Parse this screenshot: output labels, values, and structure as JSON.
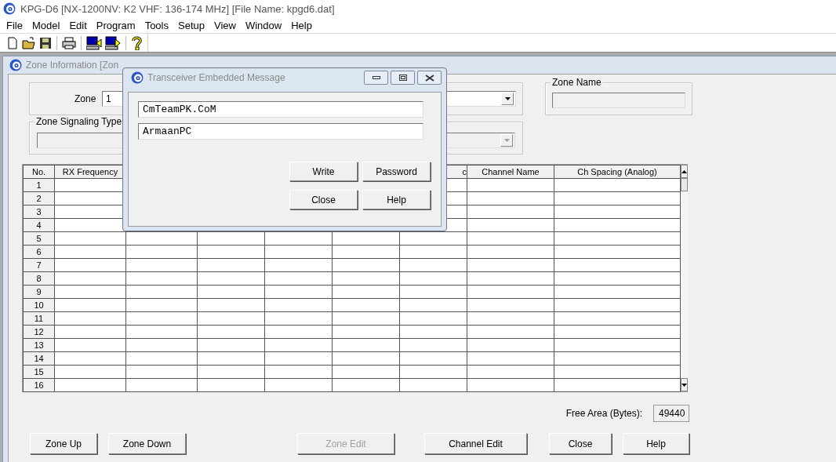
{
  "app_window": {
    "title": "KPG-D6 [NX-1200NV: K2 VHF: 136-174 MHz] [File Name: kpgd6.dat]"
  },
  "menu": [
    "File",
    "Model",
    "Edit",
    "Program",
    "Tools",
    "Setup",
    "View",
    "Window",
    "Help"
  ],
  "zone_window": {
    "title": "Zone Information [Zon",
    "zone": {
      "label": "Zone",
      "value": "1"
    },
    "zone_signaling_type": {
      "label": "Zone Signaling Type",
      "disabled": true
    },
    "zone_name": {
      "label": "Zone Name",
      "value_disabled": true
    },
    "table": {
      "columns": [
        "No.",
        "RX Frequency",
        "",
        "",
        "",
        "",
        "c",
        "Channel Name",
        "Ch Spacing (Analog)"
      ],
      "rows": [
        "1",
        "2",
        "3",
        "4",
        "5",
        "6",
        "7",
        "8",
        "9",
        "10",
        "11",
        "12",
        "13",
        "14",
        "15",
        "16"
      ]
    },
    "free_area": {
      "label": "Free Area (Bytes):",
      "value": "49440"
    },
    "buttons": [
      {
        "label": "Zone Up",
        "disabled": false
      },
      {
        "label": "Zone Down",
        "disabled": false
      },
      {
        "label": "Zone Edit",
        "disabled": true
      },
      {
        "label": "Channel Edit",
        "disabled": false
      },
      {
        "label": "Close",
        "disabled": false
      },
      {
        "label": "Help",
        "disabled": false
      }
    ]
  },
  "dialog": {
    "title": "Transceiver Embedded Message",
    "fields": [
      "CmTeamPK.CoM",
      "ArmaanPC"
    ],
    "buttons": [
      {
        "label": "Write"
      },
      {
        "label": "Password"
      },
      {
        "label": "Close"
      },
      {
        "label": "Help"
      }
    ]
  }
}
